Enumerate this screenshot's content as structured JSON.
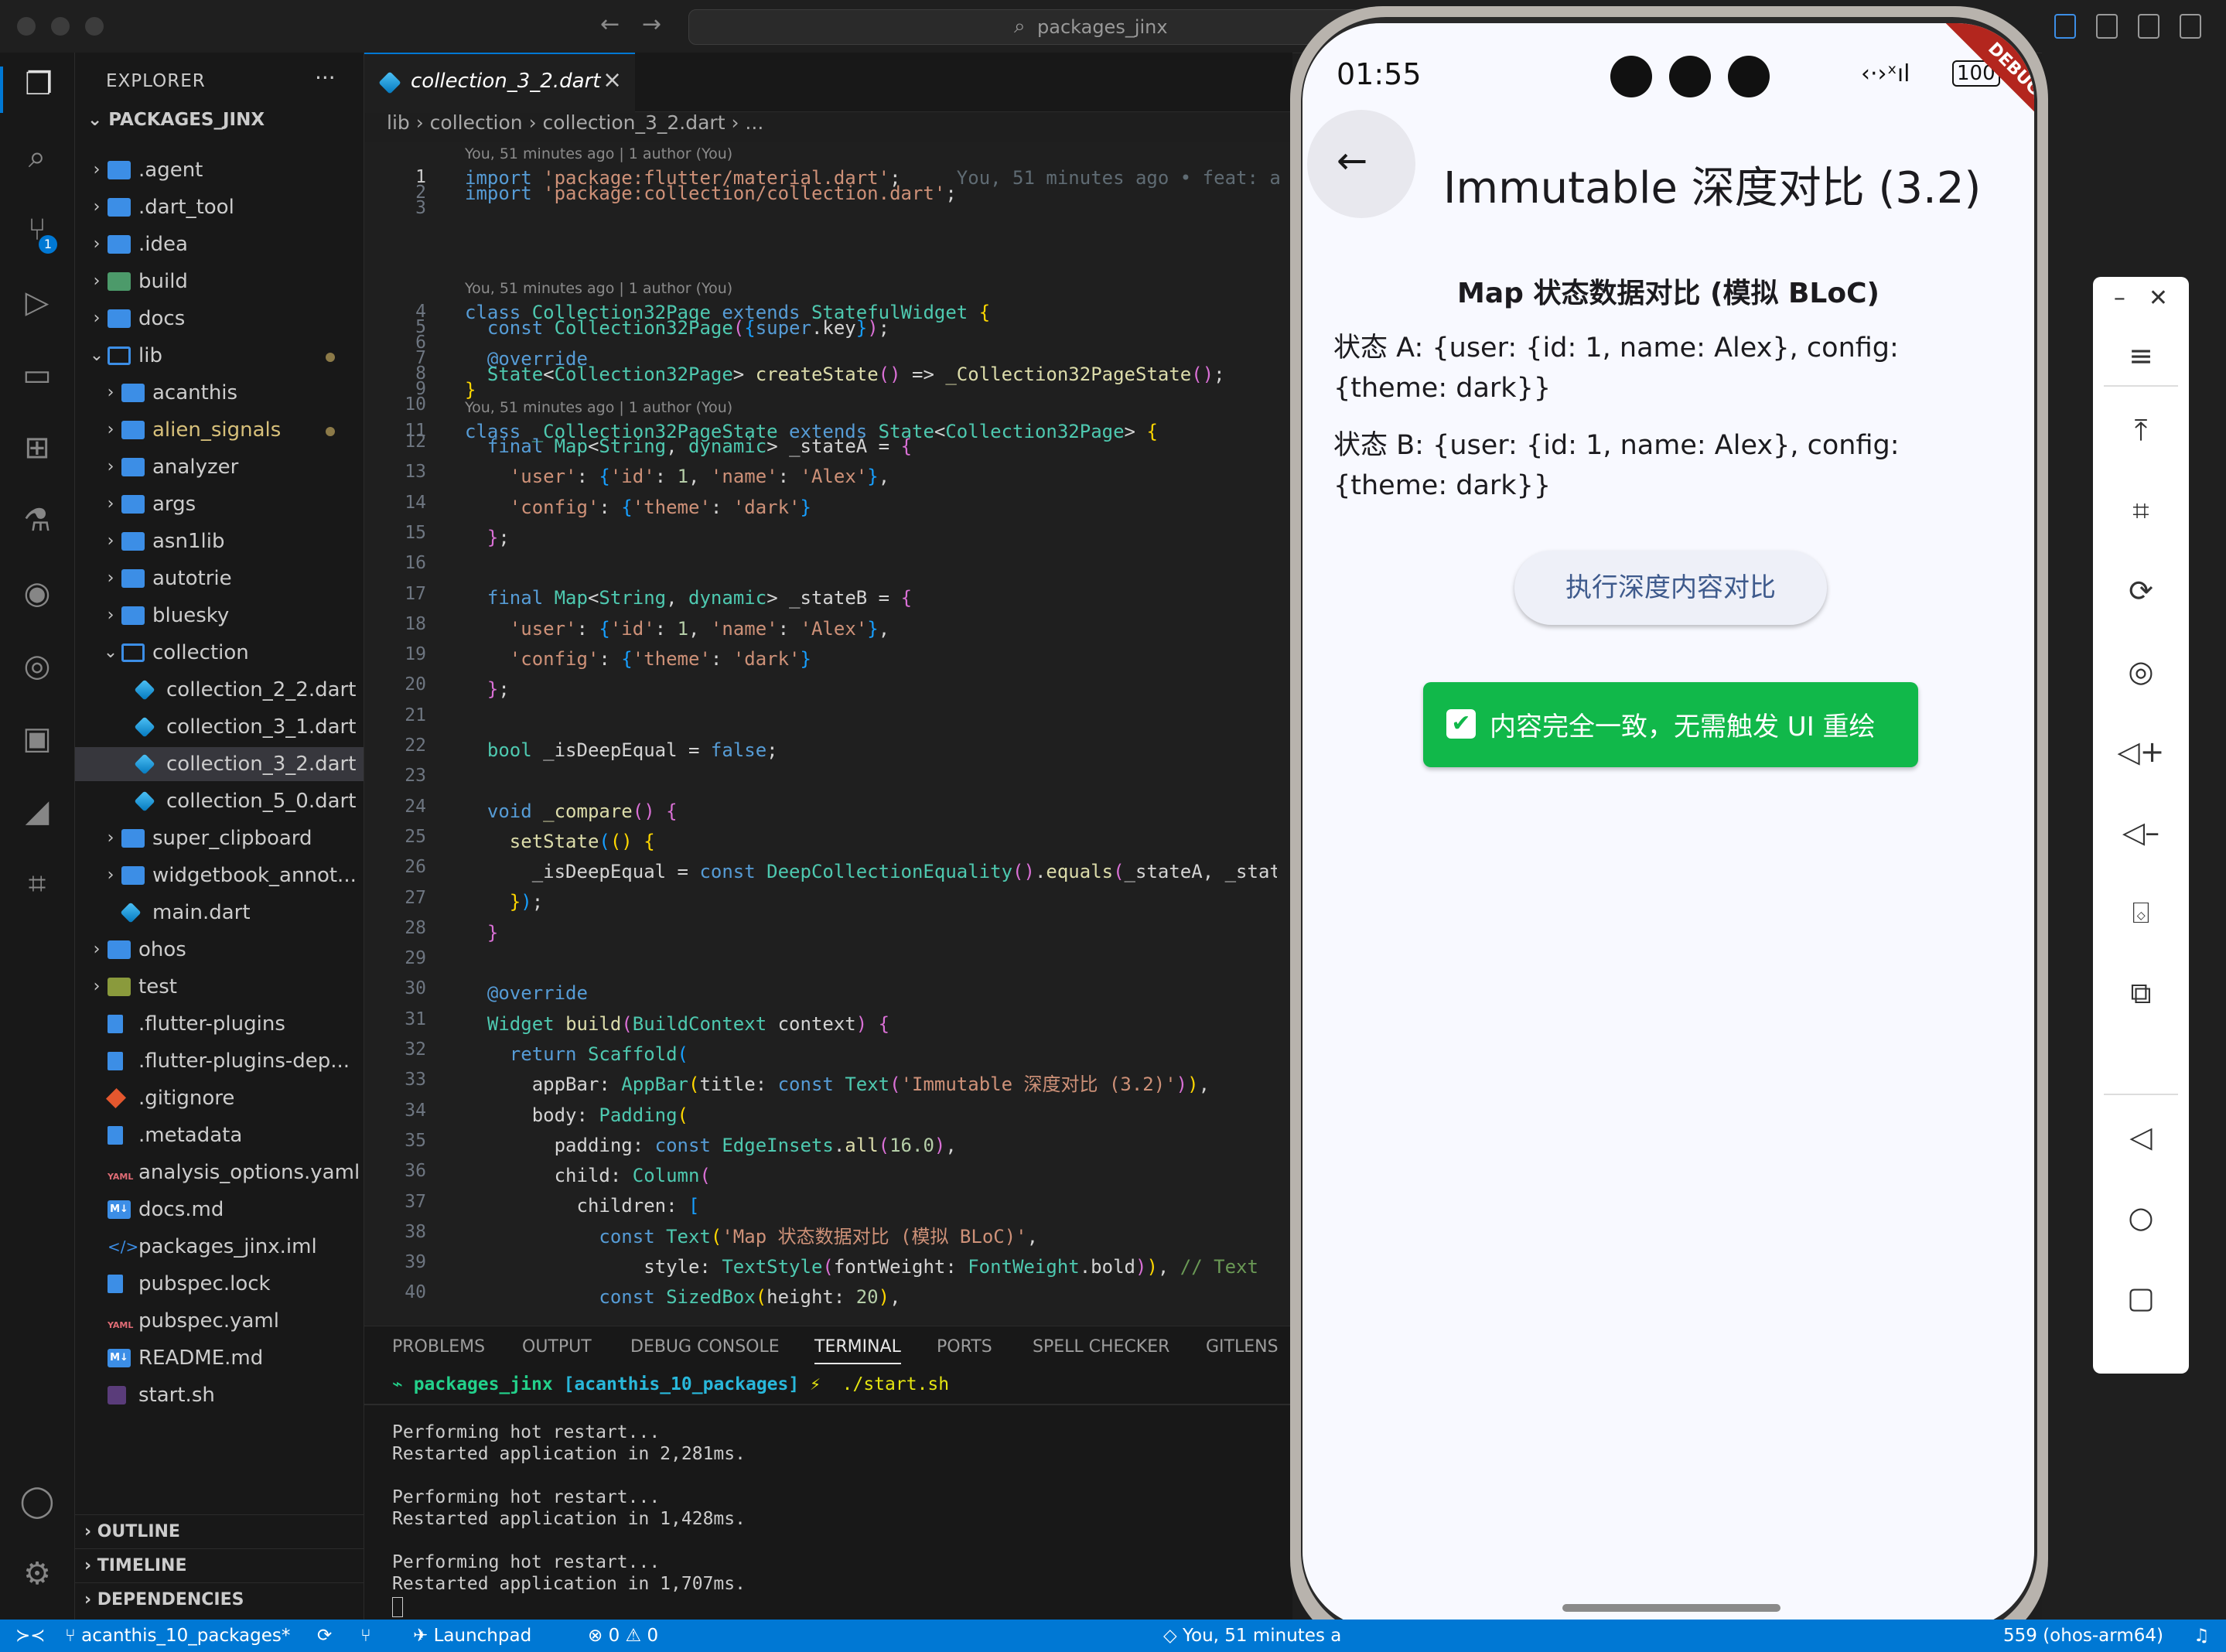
{
  "window": {
    "search_text": "packages_jinx"
  },
  "sidebar": {
    "header": "EXPLORER",
    "more": "···",
    "root": "PACKAGES_JINX",
    "items": [
      {
        "label": ".agent",
        "indent": 1,
        "kind": "folder",
        "expanded": false
      },
      {
        "label": ".dart_tool",
        "indent": 1,
        "kind": "folder",
        "expanded": false
      },
      {
        "label": ".idea",
        "indent": 1,
        "kind": "folder",
        "expanded": false
      },
      {
        "label": "build",
        "indent": 1,
        "kind": "folder-build",
        "expanded": false
      },
      {
        "label": "docs",
        "indent": 1,
        "kind": "folder",
        "expanded": false
      },
      {
        "label": "lib",
        "indent": 1,
        "kind": "folder",
        "expanded": true,
        "modified": true
      },
      {
        "label": "acanthis",
        "indent": 2,
        "kind": "folder",
        "expanded": false
      },
      {
        "label": "alien_signals",
        "indent": 2,
        "kind": "folder",
        "expanded": false,
        "modified": true
      },
      {
        "label": "analyzer",
        "indent": 2,
        "kind": "folder",
        "expanded": false
      },
      {
        "label": "args",
        "indent": 2,
        "kind": "folder",
        "expanded": false
      },
      {
        "label": "asn1lib",
        "indent": 2,
        "kind": "folder",
        "expanded": false
      },
      {
        "label": "autotrie",
        "indent": 2,
        "kind": "folder",
        "expanded": false
      },
      {
        "label": "bluesky",
        "indent": 2,
        "kind": "folder",
        "expanded": false
      },
      {
        "label": "collection",
        "indent": 2,
        "kind": "folder",
        "expanded": true
      },
      {
        "label": "collection_2_2.dart",
        "indent": 3,
        "kind": "dart"
      },
      {
        "label": "collection_3_1.dart",
        "indent": 3,
        "kind": "dart"
      },
      {
        "label": "collection_3_2.dart",
        "indent": 3,
        "kind": "dart",
        "selected": true
      },
      {
        "label": "collection_5_0.dart",
        "indent": 3,
        "kind": "dart"
      },
      {
        "label": "super_clipboard",
        "indent": 2,
        "kind": "folder",
        "expanded": false
      },
      {
        "label": "widgetbook_annot...",
        "indent": 2,
        "kind": "folder",
        "expanded": false
      },
      {
        "label": "main.dart",
        "indent": 2,
        "kind": "dart"
      },
      {
        "label": "ohos",
        "indent": 1,
        "kind": "folder",
        "expanded": false
      },
      {
        "label": "test",
        "indent": 1,
        "kind": "folder-test",
        "expanded": false
      },
      {
        "label": ".flutter-plugins",
        "indent": 1,
        "kind": "file"
      },
      {
        "label": ".flutter-plugins-dep...",
        "indent": 1,
        "kind": "file"
      },
      {
        "label": ".gitignore",
        "indent": 1,
        "kind": "git"
      },
      {
        "label": ".metadata",
        "indent": 1,
        "kind": "file"
      },
      {
        "label": "analysis_options.yaml",
        "indent": 1,
        "kind": "yaml"
      },
      {
        "label": "docs.md",
        "indent": 1,
        "kind": "md"
      },
      {
        "label": "packages_jinx.iml",
        "indent": 1,
        "kind": "xml"
      },
      {
        "label": "pubspec.lock",
        "indent": 1,
        "kind": "file"
      },
      {
        "label": "pubspec.yaml",
        "indent": 1,
        "kind": "yaml"
      },
      {
        "label": "README.md",
        "indent": 1,
        "kind": "md"
      },
      {
        "label": "start.sh",
        "indent": 1,
        "kind": "sh"
      }
    ],
    "bottom": {
      "outline": "OUTLINE",
      "timeline": "TIMELINE",
      "dependencies": "DEPENDENCIES"
    },
    "scm_badge": "1"
  },
  "editor": {
    "tab_label": "collection_3_2.dart",
    "tab_close": "×",
    "breadcrumb": [
      "lib",
      "collection",
      "collection_3_2.dart",
      "..."
    ],
    "lens_1": "You, 51 minutes ago | 1 author (You)",
    "lens_2": "You, 51 minutes ago | 1 author (You)",
    "lens_3": "You, 51 minutes ago | 1 author (You)",
    "blame_line1": "You, 51 minutes ago • feat: a",
    "line_numbers": [
      "1",
      "2",
      "3",
      "4",
      "5",
      "6",
      "7",
      "8",
      "9",
      "10",
      "11",
      "12",
      "13",
      "14",
      "15",
      "16",
      "17",
      "18",
      "19",
      "20",
      "21",
      "22",
      "23",
      "24",
      "25",
      "26",
      "27",
      "28",
      "29",
      "30",
      "31",
      "32",
      "33",
      "34",
      "35",
      "36",
      "37",
      "38",
      "39",
      "40"
    ]
  },
  "panel": {
    "tabs": [
      "PROBLEMS",
      "OUTPUT",
      "DEBUG CONSOLE",
      "TERMINAL",
      "PORTS",
      "SPELL CHECKER",
      "GITLENS"
    ],
    "active_tab": "TERMINAL",
    "prompt_dir": "packages_jinx",
    "prompt_branch": "[acanthis_10_packages]",
    "prompt_symbol": "⚡",
    "prompt_cmd": "./start.sh",
    "lines": [
      "Performing hot restart...",
      "Restarted application in 2,281ms.",
      "",
      "Performing hot restart...",
      "Restarted application in 1,428ms.",
      "",
      "Performing hot restart...",
      "Restarted application in 1,707ms."
    ]
  },
  "statusbar": {
    "branch": "acanthis_10_packages*",
    "launchpad": "Launchpad",
    "errors": "0",
    "warnings": "0",
    "blame": "You, 51 minutes a",
    "device": "559 (ohos-arm64)"
  },
  "phone": {
    "time": "01:55",
    "battery": "100",
    "debug_banner": "DEBUG",
    "appbar_title": "Immutable 深度对比 (3.2)",
    "subtitle": "Map 状态数据对比 (模拟 BLoC)",
    "state_a": "状态 A: {user: {id: 1, name: Alex}, config: {theme: dark}}",
    "state_b": "状态 B: {user: {id: 1, name: Alex}, config: {theme: dark}}",
    "compare_button": "执行深度内容对比",
    "result_text": "内容完全一致，无需触发 UI 重绘",
    "result_check": "✔"
  },
  "colors": {
    "accent": "#0078d4",
    "success": "#11b84a",
    "debug_red": "#b3261e"
  }
}
